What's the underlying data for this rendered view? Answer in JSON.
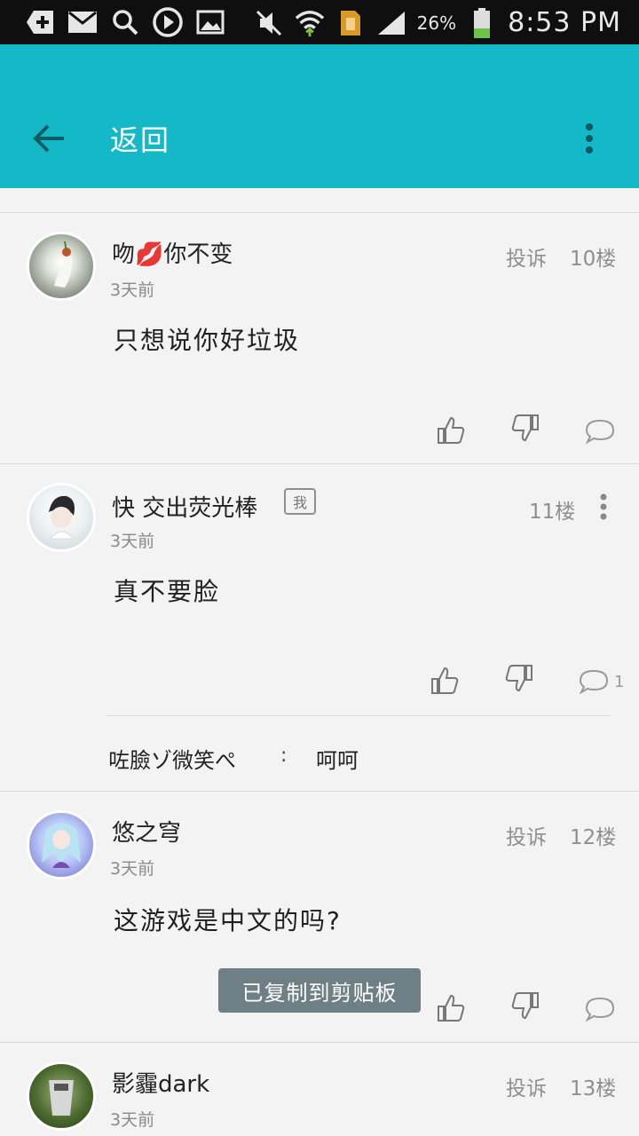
{
  "status_bar": {
    "battery": "26%",
    "time": "8:53 PM"
  },
  "appbar": {
    "title": "返回"
  },
  "comments": [
    {
      "name": "吻💋你不变",
      "time": "3天前",
      "report": "投诉",
      "floor": "10楼",
      "text": "只想说你好垃圾"
    },
    {
      "name": "快 交出荧光棒",
      "badge": "我",
      "time": "3天前",
      "floor": "11楼",
      "text": "真不要脸",
      "reply_count": "1",
      "reply": {
        "name": "咗臉ゾ微笑ぺ",
        "colon": ":",
        "text": "呵呵"
      }
    },
    {
      "name": "悠之穹",
      "time": "3天前",
      "report": "投诉",
      "floor": "12楼",
      "text": "这游戏是中文的吗?"
    },
    {
      "name": "影霾dark",
      "time": "3天前",
      "report": "投诉",
      "floor": "13楼"
    }
  ],
  "toast": "已复制到剪贴板",
  "colors": {
    "appbar": "#14b8c7",
    "statusbar": "#0f0f0f",
    "background": "#f3f3f3"
  }
}
